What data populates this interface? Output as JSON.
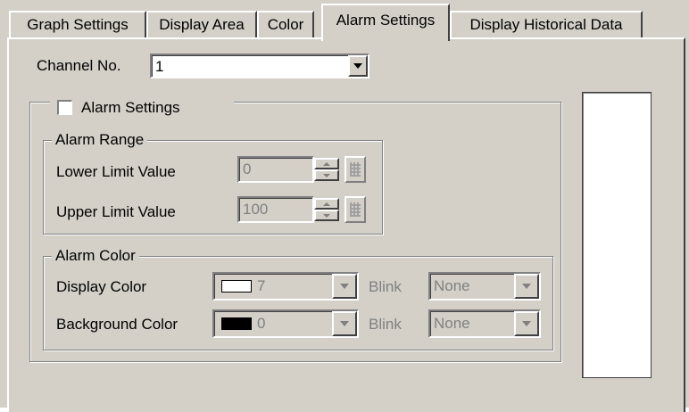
{
  "tabs": [
    {
      "label": "Graph Settings",
      "active": false
    },
    {
      "label": "Display Area",
      "active": false
    },
    {
      "label": "Color",
      "active": false
    },
    {
      "label": "Alarm Settings",
      "active": true
    },
    {
      "label": "Display Historical Data",
      "active": false
    }
  ],
  "channel": {
    "label": "Channel No.",
    "value": "1"
  },
  "alarm_settings": {
    "checkbox_label": "Alarm Settings",
    "checked": false,
    "range": {
      "title": "Alarm Range",
      "lower_label": "Lower Limit Value",
      "lower_value": "0",
      "upper_label": "Upper Limit Value",
      "upper_value": "100"
    },
    "color": {
      "title": "Alarm Color",
      "display_label": "Display Color",
      "display_value": "7",
      "display_swatch": "#ffffff",
      "display_blink_label": "Blink",
      "display_blink_value": "None",
      "background_label": "Background Color",
      "background_value": "0",
      "background_swatch": "#000000",
      "background_blink_label": "Blink",
      "background_blink_value": "None"
    }
  },
  "colors": {
    "face": "#d4d0c8",
    "disabled_text": "#808080"
  }
}
